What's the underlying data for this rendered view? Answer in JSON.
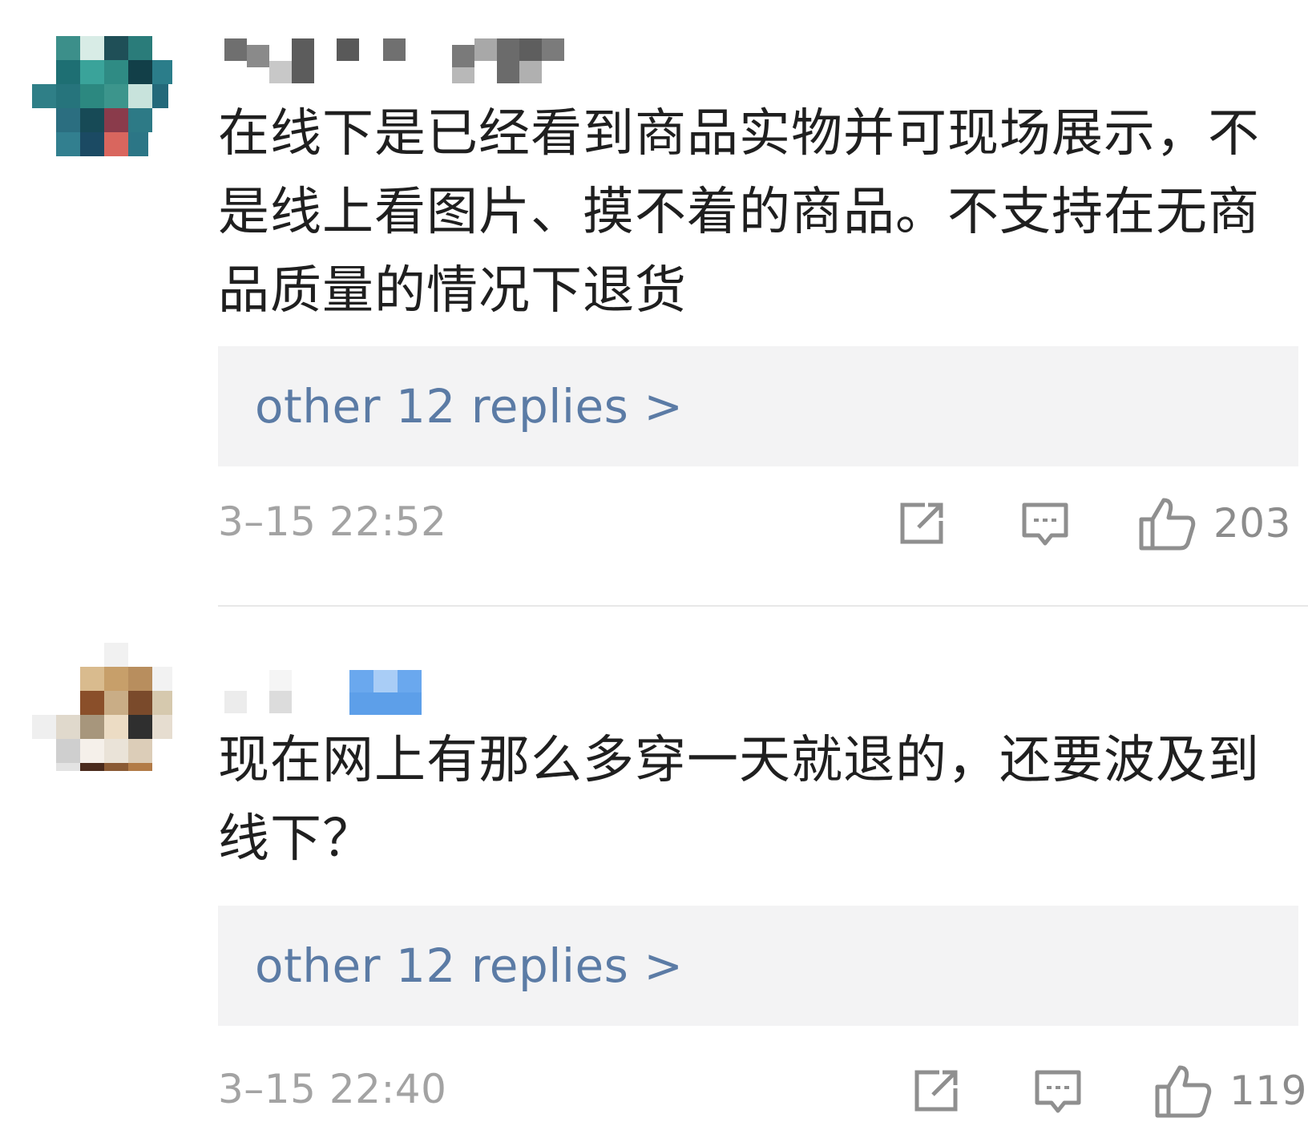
{
  "comments": [
    {
      "avatar_icon": "pixelated-avatar-teal",
      "username_icon": "pixelated-username-redacted",
      "text": "在线下是已经看到商品实物并可现场展示，不是线上看图片、摸不着的商品。不支持在无商品质量的情况下退货",
      "replies_label": "other 12 replies >",
      "timestamp": "3–15 22:52",
      "like_count": "203"
    },
    {
      "avatar_icon": "pixelated-avatar-beige",
      "username_icon": "pixelated-username-redacted",
      "text": "现在网上有那么多穿一天就退的，还要波及到线下？",
      "replies_label": "other 12 replies >",
      "timestamp": "3–15 22:40",
      "like_count": "119"
    }
  ],
  "colors": {
    "reply_link": "#5b7ba5",
    "meta_gray": "#a3a3a3",
    "reply_box_bg": "#f3f3f4",
    "text": "#1f1f1f"
  }
}
